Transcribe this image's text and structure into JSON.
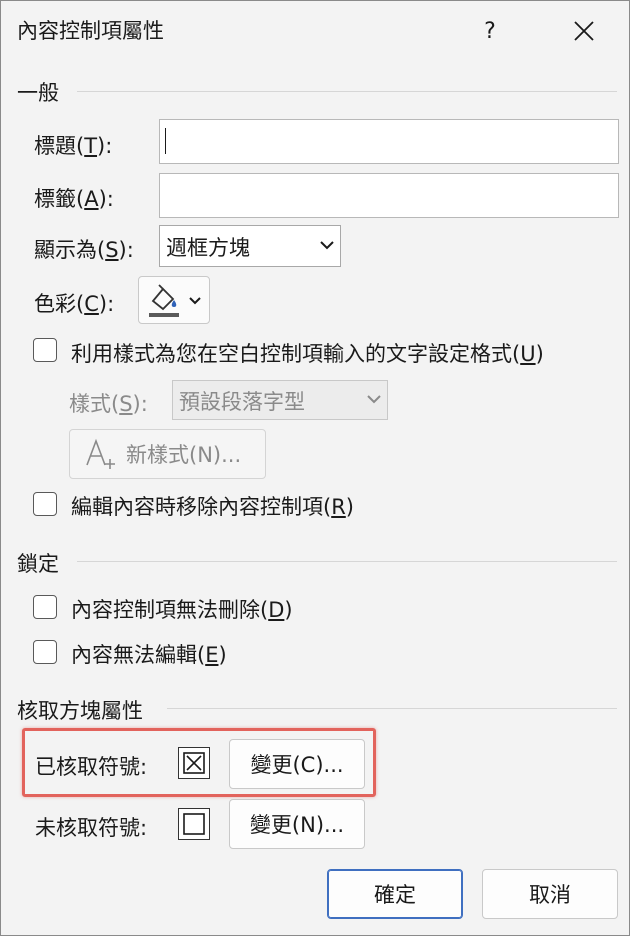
{
  "dialog": {
    "title": "內容控制項屬性",
    "help": "?",
    "close": "✕"
  },
  "general": {
    "header": "一般",
    "title_label": "標題(",
    "title_key": "T",
    "title_end": "):",
    "title_value": "",
    "tag_label": "標籤(",
    "tag_key": "A",
    "tag_end": "):",
    "tag_value": "",
    "show_as_label": "顯示為(",
    "show_as_key": "S",
    "show_as_end": "):",
    "show_as_value": "週框方塊",
    "color_label": "色彩(",
    "color_key": "C",
    "color_end": "):",
    "use_style_label": "利用樣式為您在空白控制項輸入的文字設定格式(",
    "use_style_key": "U",
    "use_style_end": ")",
    "style_label": "樣式(",
    "style_key": "S",
    "style_end": "):",
    "style_value": "預設段落字型",
    "new_style_label": "新樣式(",
    "new_style_key": "N",
    "new_style_end": ")...",
    "remove_label": "編輯內容時移除內容控制項(",
    "remove_key": "R",
    "remove_end": ")"
  },
  "locking": {
    "header": "鎖定",
    "cannot_delete_label": "內容控制項無法刪除(",
    "cannot_delete_key": "D",
    "cannot_delete_end": ")",
    "cannot_edit_label": "內容無法編輯(",
    "cannot_edit_key": "E",
    "cannot_edit_end": ")"
  },
  "checkbox_props": {
    "header": "核取方塊屬性",
    "checked_label": "已核取符號:",
    "checked_change": "變更(",
    "checked_change_key": "C",
    "checked_change_end": ")...",
    "unchecked_label": "未核取符號:",
    "unchecked_change": "變更(",
    "unchecked_change_key": "N",
    "unchecked_change_end": ")..."
  },
  "footer": {
    "ok": "確定",
    "cancel": "取消"
  },
  "colors": {
    "highlight": "#e2635c",
    "primary_border": "#3f6fc0"
  }
}
